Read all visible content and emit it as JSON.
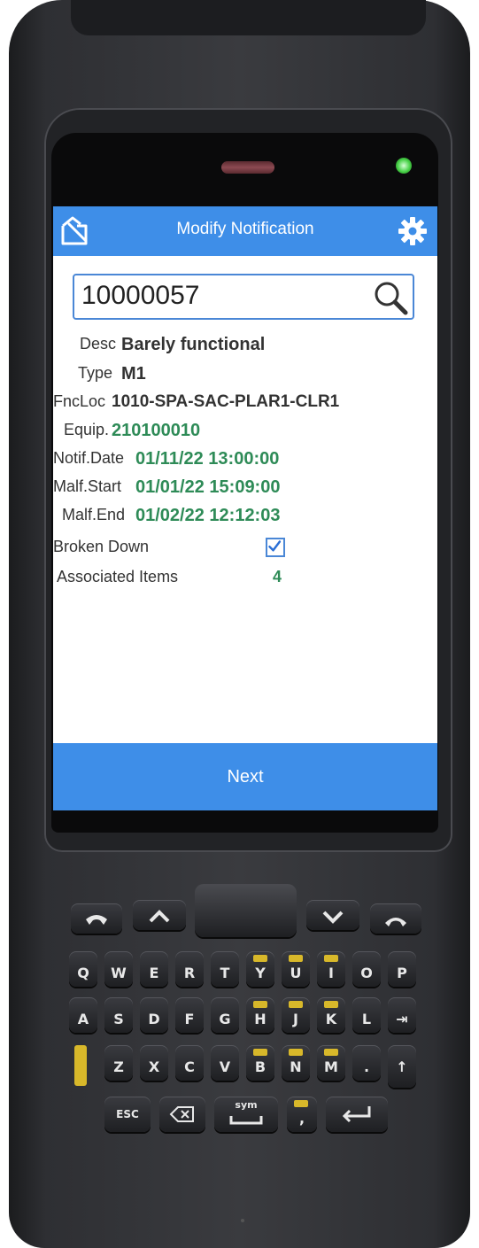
{
  "header": {
    "title": "Modify Notification"
  },
  "search": {
    "value": "10000057"
  },
  "fields": {
    "desc_label": "Desc",
    "desc_value": "Barely functional",
    "type_label": "Type",
    "type_value": "M1",
    "fncloc_label": "FncLoc",
    "fncloc_value": "1010-SPA-SAC-PLAR1-CLR1",
    "equip_label": "Equip.",
    "equip_value": "210100010",
    "notif_date_label": "Notif.Date",
    "notif_date_value": "01/11/22 13:00:00",
    "malf_start_label": "Malf.Start",
    "malf_start_value": "01/01/22 15:09:00",
    "malf_end_label": "Malf.End",
    "malf_end_value": "01/02/22 12:12:03",
    "broken_down_label": "Broken Down",
    "broken_down_checked": true,
    "associated_items_label": "Associated Items",
    "associated_items_value": "4"
  },
  "footer": {
    "next_label": "Next"
  },
  "keypad": {
    "row1": [
      "Q",
      "W",
      "E",
      "R",
      "T",
      "Y",
      "U",
      "I",
      "O",
      "P"
    ],
    "row2": [
      "A",
      "S",
      "D",
      "F",
      "G",
      "H",
      "J",
      "K",
      "L",
      "⇥"
    ],
    "row3": [
      "Z",
      "X",
      "C",
      "V",
      "B",
      "N",
      "M",
      ".",
      "↑"
    ],
    "esc_label": "ESC",
    "sym_label": "sym"
  },
  "colors": {
    "header_blue": "#3e8ee8",
    "value_green": "#2e8b57",
    "accent_yellow": "#d8b82a"
  }
}
